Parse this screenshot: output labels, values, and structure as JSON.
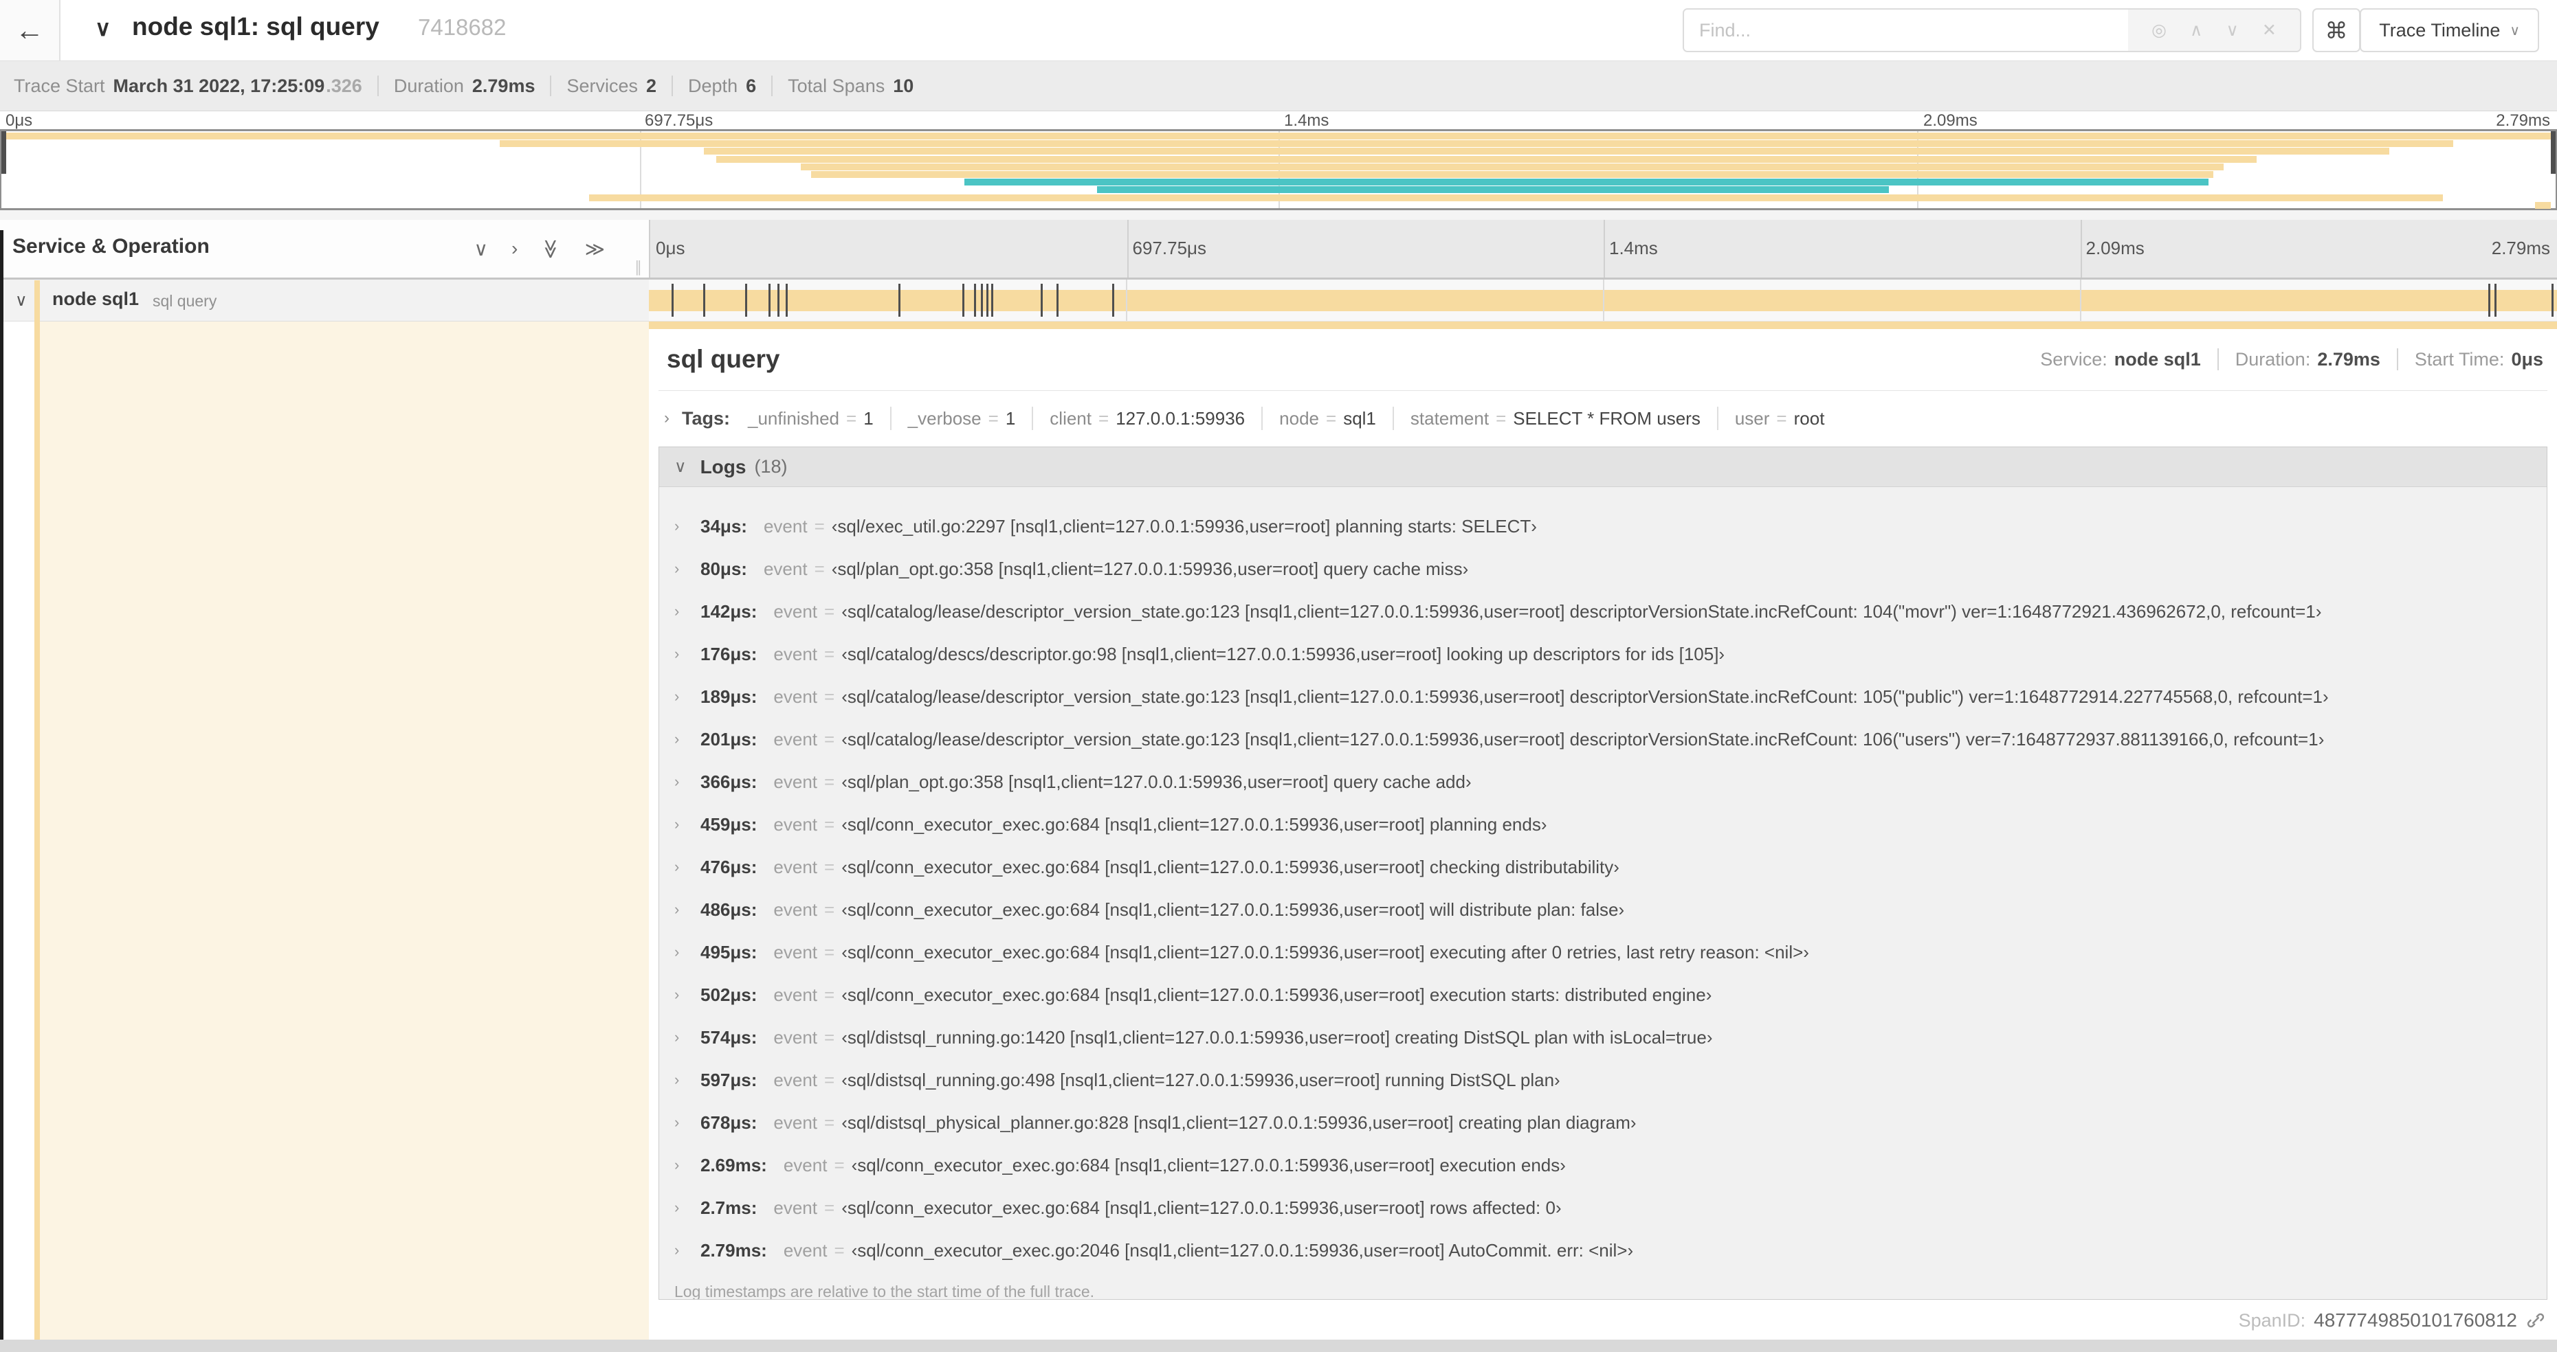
{
  "colors": {
    "tan": "#F7DBA0",
    "teal": "#4BC4C4",
    "cream": "#FCF4E3"
  },
  "header": {
    "back_icon": "←",
    "collapse_icon": "∨",
    "title": "node sql1: sql query",
    "trace_id": "7418682",
    "find_placeholder": "Find...",
    "find_icons": {
      "match": "◎",
      "prev": "∧",
      "next": "∨",
      "clear": "✕"
    },
    "shortcut_icon": "⌘",
    "view_selector": "Trace Timeline",
    "view_selector_chevron": "∨"
  },
  "meta": {
    "items": [
      {
        "label": "Trace Start",
        "value": "March 31 2022, 17:25:09",
        "suffix": ".326"
      },
      {
        "label": "Duration",
        "value": "2.79ms"
      },
      {
        "label": "Services",
        "value": "2"
      },
      {
        "label": "Depth",
        "value": "6"
      },
      {
        "label": "Total Spans",
        "value": "10"
      }
    ]
  },
  "minimap": {
    "labels": [
      {
        "text": "0μs",
        "pct": 0
      },
      {
        "text": "697.75μs",
        "pct": 25
      },
      {
        "text": "1.4ms",
        "pct": 50
      },
      {
        "text": "2.09ms",
        "pct": 75
      },
      {
        "text": "2.79ms",
        "pct": 100
      }
    ],
    "grid_pcts": [
      25,
      50,
      75
    ],
    "spans": [
      {
        "start": 0,
        "end": 100,
        "color": "tan"
      },
      {
        "start": 19.5,
        "end": 96.0,
        "color": "tan"
      },
      {
        "start": 27.5,
        "end": 93.5,
        "color": "tan"
      },
      {
        "start": 28.0,
        "end": 88.3,
        "color": "tan"
      },
      {
        "start": 31.3,
        "end": 87.0,
        "color": "tan"
      },
      {
        "start": 31.7,
        "end": 86.6,
        "color": "tan"
      },
      {
        "start": 37.7,
        "end": 86.4,
        "color": "teal"
      },
      {
        "start": 42.9,
        "end": 73.9,
        "color": "teal"
      },
      {
        "start": 23.0,
        "end": 95.6,
        "color": "tan"
      },
      {
        "start": 99.2,
        "end": 99.8,
        "color": "tan"
      }
    ]
  },
  "timeline": {
    "left_header": "Service & Operation",
    "collapse_icons": {
      "collapse_one": "∨",
      "expand_one": "›",
      "collapse_all": "≫",
      "expand_all": "≫"
    },
    "ruler": [
      {
        "text": "0μs",
        "pct": 0
      },
      {
        "text": "697.75μs",
        "pct": 25
      },
      {
        "text": "1.4ms",
        "pct": 50
      },
      {
        "text": "2.09ms",
        "pct": 75
      },
      {
        "text": "2.79ms",
        "pct": 100
      }
    ],
    "grid_pcts": [
      25,
      50,
      75
    ],
    "row": {
      "chevron": "∨",
      "service": "node sql1",
      "operation": "sql query"
    },
    "log_tick_percents": [
      1.22,
      2.87,
      5.09,
      6.31,
      6.77,
      7.2,
      13.12,
      16.45,
      17.06,
      17.42,
      17.74,
      17.99,
      20.57,
      21.4,
      24.3,
      96.42,
      96.77,
      99.75
    ]
  },
  "detail": {
    "title": "sql query",
    "service_label": "Service:",
    "service_value": "node sql1",
    "duration_label": "Duration:",
    "duration_value": "2.79ms",
    "start_label": "Start Time:",
    "start_value": "0μs",
    "tags_chevron": "›",
    "tags_label": "Tags:",
    "tags": [
      {
        "key": "_unfinished",
        "value": "1"
      },
      {
        "key": "_verbose",
        "value": "1"
      },
      {
        "key": "client",
        "value": "127.0.0.1:59936"
      },
      {
        "key": "node",
        "value": "sql1"
      },
      {
        "key": "statement",
        "value": "SELECT * FROM users"
      },
      {
        "key": "user",
        "value": "root"
      }
    ],
    "logs_chevron": "∨",
    "logs_label": "Logs",
    "logs_count": "(18)",
    "log_key": "event",
    "logs": [
      {
        "time": "34μs:",
        "value": "‹sql/exec_util.go:2297 [nsql1,client=127.0.0.1:59936,user=root] planning starts: SELECT›"
      },
      {
        "time": "80μs:",
        "value": "‹sql/plan_opt.go:358 [nsql1,client=127.0.0.1:59936,user=root] query cache miss›"
      },
      {
        "time": "142μs:",
        "value": "‹sql/catalog/lease/descriptor_version_state.go:123 [nsql1,client=127.0.0.1:59936,user=root] descriptorVersionState.incRefCount: 104(\"movr\") ver=1:1648772921.436962672,0, refcount=1›"
      },
      {
        "time": "176μs:",
        "value": "‹sql/catalog/descs/descriptor.go:98 [nsql1,client=127.0.0.1:59936,user=root] looking up descriptors for ids [105]›"
      },
      {
        "time": "189μs:",
        "value": "‹sql/catalog/lease/descriptor_version_state.go:123 [nsql1,client=127.0.0.1:59936,user=root] descriptorVersionState.incRefCount: 105(\"public\") ver=1:1648772914.227745568,0, refcount=1›"
      },
      {
        "time": "201μs:",
        "value": "‹sql/catalog/lease/descriptor_version_state.go:123 [nsql1,client=127.0.0.1:59936,user=root] descriptorVersionState.incRefCount: 106(\"users\") ver=7:1648772937.881139166,0, refcount=1›"
      },
      {
        "time": "366μs:",
        "value": "‹sql/plan_opt.go:358 [nsql1,client=127.0.0.1:59936,user=root] query cache add›"
      },
      {
        "time": "459μs:",
        "value": "‹sql/conn_executor_exec.go:684 [nsql1,client=127.0.0.1:59936,user=root] planning ends›"
      },
      {
        "time": "476μs:",
        "value": "‹sql/conn_executor_exec.go:684 [nsql1,client=127.0.0.1:59936,user=root] checking distributability›"
      },
      {
        "time": "486μs:",
        "value": "‹sql/conn_executor_exec.go:684 [nsql1,client=127.0.0.1:59936,user=root] will distribute plan: false›"
      },
      {
        "time": "495μs:",
        "value": "‹sql/conn_executor_exec.go:684 [nsql1,client=127.0.0.1:59936,user=root] executing after 0 retries, last retry reason: <nil>›"
      },
      {
        "time": "502μs:",
        "value": "‹sql/conn_executor_exec.go:684 [nsql1,client=127.0.0.1:59936,user=root] execution starts: distributed engine›"
      },
      {
        "time": "574μs:",
        "value": "‹sql/distsql_running.go:1420 [nsql1,client=127.0.0.1:59936,user=root] creating DistSQL plan with isLocal=true›"
      },
      {
        "time": "597μs:",
        "value": "‹sql/distsql_running.go:498 [nsql1,client=127.0.0.1:59936,user=root] running DistSQL plan›"
      },
      {
        "time": "678μs:",
        "value": "‹sql/distsql_physical_planner.go:828 [nsql1,client=127.0.0.1:59936,user=root] creating plan diagram›"
      },
      {
        "time": "2.69ms:",
        "value": "‹sql/conn_executor_exec.go:684 [nsql1,client=127.0.0.1:59936,user=root] execution ends›"
      },
      {
        "time": "2.7ms:",
        "value": "‹sql/conn_executor_exec.go:684 [nsql1,client=127.0.0.1:59936,user=root] rows affected: 0›"
      },
      {
        "time": "2.79ms:",
        "value": "‹sql/conn_executor_exec.go:2046 [nsql1,client=127.0.0.1:59936,user=root] AutoCommit. err: <nil>›"
      }
    ],
    "footer": "Log timestamps are relative to the start time of the full trace.",
    "span_id_label": "SpanID:",
    "span_id": "4877749850101760812"
  }
}
